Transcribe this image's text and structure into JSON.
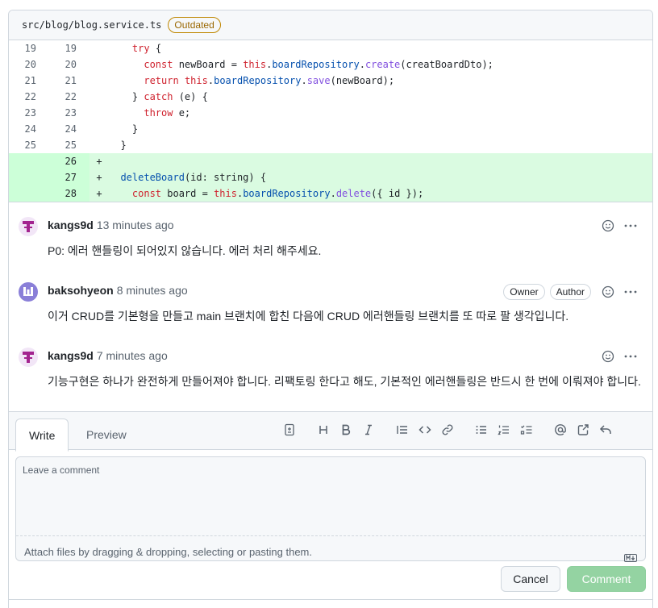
{
  "file": {
    "path": "src/blog/blog.service.ts",
    "badge": "Outdated"
  },
  "diff": [
    {
      "old": "19",
      "new": "19",
      "marker": "",
      "type": "context"
    },
    {
      "old": "20",
      "new": "20",
      "marker": "",
      "type": "context"
    },
    {
      "old": "21",
      "new": "21",
      "marker": "",
      "type": "context"
    },
    {
      "old": "22",
      "new": "22",
      "marker": "",
      "type": "context"
    },
    {
      "old": "23",
      "new": "23",
      "marker": "",
      "type": "context"
    },
    {
      "old": "24",
      "new": "24",
      "marker": "",
      "type": "context"
    },
    {
      "old": "25",
      "new": "25",
      "marker": "",
      "type": "context"
    },
    {
      "old": "",
      "new": "26",
      "marker": "+",
      "type": "add"
    },
    {
      "old": "",
      "new": "27",
      "marker": "+",
      "type": "add"
    },
    {
      "old": "",
      "new": "28",
      "marker": "+",
      "type": "add"
    }
  ],
  "comments": [
    {
      "author": "kangs9d",
      "time": "13 minutes ago",
      "body": "P0: 에러 핸들링이 되어있지 않습니다. 에러 처리 해주세요."
    },
    {
      "author": "baksohyeon",
      "time": "8 minutes ago",
      "badges": [
        "Owner",
        "Author"
      ],
      "body": "이거 CRUD를 기본형을 만들고 main 브랜치에 합친 다음에 CRUD 에러핸들링 브랜치를 또 따로 팔 생각입니다."
    },
    {
      "author": "kangs9d",
      "time": "7 minutes ago",
      "body": "기능구현은 하나가 완전하게 만들어져야 합니다. 리팩토링 한다고 해도, 기본적인 에러핸들링은 반드시 한 번에 이뤄져야 합니다."
    }
  ],
  "editor": {
    "tab_write": "Write",
    "tab_preview": "Preview",
    "placeholder": "Leave a comment",
    "attach_text": "Attach files by dragging & dropping, selecting or pasting them.",
    "cancel_label": "Cancel",
    "comment_label": "Comment"
  },
  "colors": {
    "add_bg": "#dafbe1",
    "add_gutter": "#ccffd8",
    "comment_btn_disabled": "#94d3a2",
    "badge_outdated": "#9a6700"
  }
}
